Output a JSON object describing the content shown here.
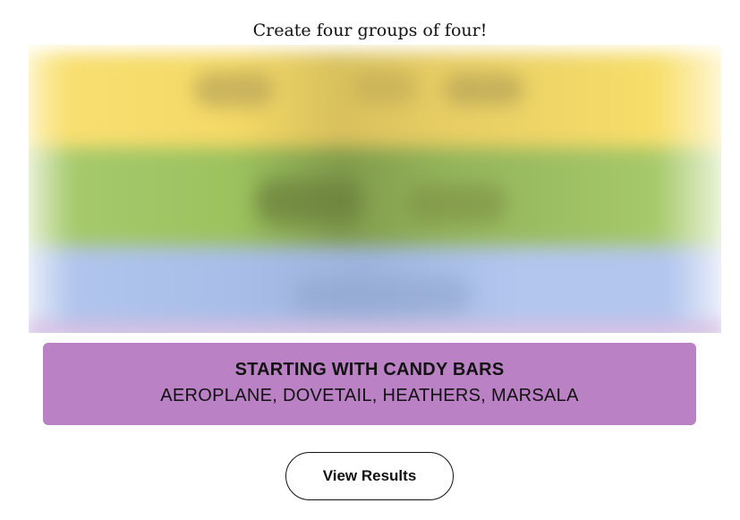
{
  "prompt": "Create four groups of four!",
  "solved_group": {
    "title": "STARTING WITH CANDY BARS",
    "members": "AEROPLANE, DOVETAIL, HEATHERS, MARSALA",
    "color": "#ba81c5"
  },
  "hidden_group_colors": [
    "#f4d966",
    "#a0c35a",
    "#b0c4ef"
  ],
  "view_results_label": "View Results"
}
